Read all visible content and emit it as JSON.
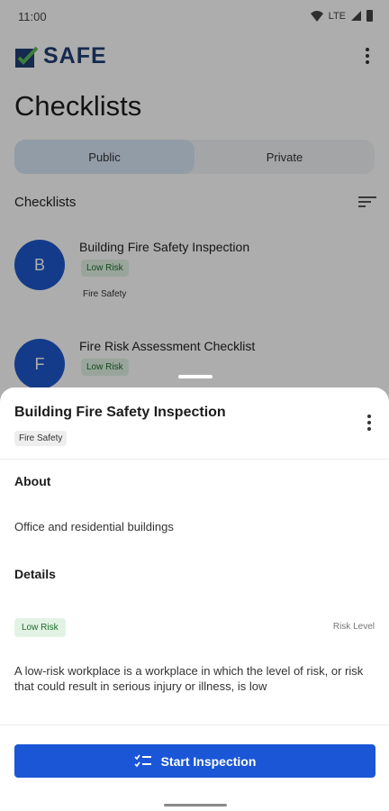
{
  "status_bar": {
    "time": "11:00",
    "network": "LTE"
  },
  "app": {
    "logo_text": "SAFE",
    "brand_color": "#1f3f74",
    "accent_color": "#1a56d6"
  },
  "page": {
    "title": "Checklists"
  },
  "segments": {
    "public": "Public",
    "private": "Private",
    "selected": "Public"
  },
  "list": {
    "section_label": "Checklists",
    "items": [
      {
        "initial": "B",
        "title": "Building Fire Safety Inspection",
        "risk": "Low Risk",
        "category": "Fire Safety"
      },
      {
        "initial": "F",
        "title": "Fire Risk Assessment Checklist",
        "risk": "Low Risk"
      }
    ]
  },
  "sheet": {
    "title": "Building Fire Safety Inspection",
    "category": "Fire Safety",
    "about_heading": "About",
    "about_text": "Office and residential buildings",
    "details_heading": "Details",
    "risk_chip": "Low Risk",
    "risk_kind": "Risk Level",
    "risk_description": "A low-risk workplace is a workplace in which the level of risk, or risk that could result in serious injury or illness, is low",
    "start_button": "Start Inspection"
  }
}
